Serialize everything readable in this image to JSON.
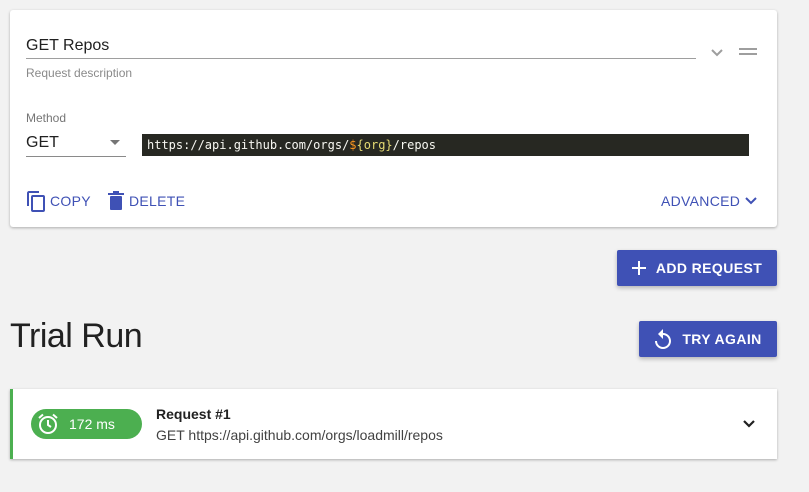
{
  "request": {
    "name": "GET Repos",
    "description_placeholder": "Request description",
    "method_label": "Method",
    "method_value": "GET",
    "url_prefix": "https://api.github.com/orgs/",
    "url_var_dollar": "$",
    "url_var_name": "{org}",
    "url_suffix": "/repos",
    "copy_label": "COPY",
    "delete_label": "DELETE",
    "advanced_label": "ADVANCED"
  },
  "add_request_label": "ADD REQUEST",
  "trial": {
    "title": "Trial Run",
    "try_again_label": "TRY AGAIN",
    "result": {
      "time": "172 ms",
      "title": "Request #1",
      "method": "GET",
      "url": "https://api.github.com/orgs/loadmill/repos"
    }
  },
  "colors": {
    "accent": "#3f51b5",
    "success": "#4caf50",
    "url_bg": "#272822"
  },
  "icons": [
    "chevron-down-icon",
    "drag-handle-icon",
    "copy-icon",
    "trash-icon",
    "plus-icon",
    "replay-icon",
    "alarm-clock-icon"
  ]
}
